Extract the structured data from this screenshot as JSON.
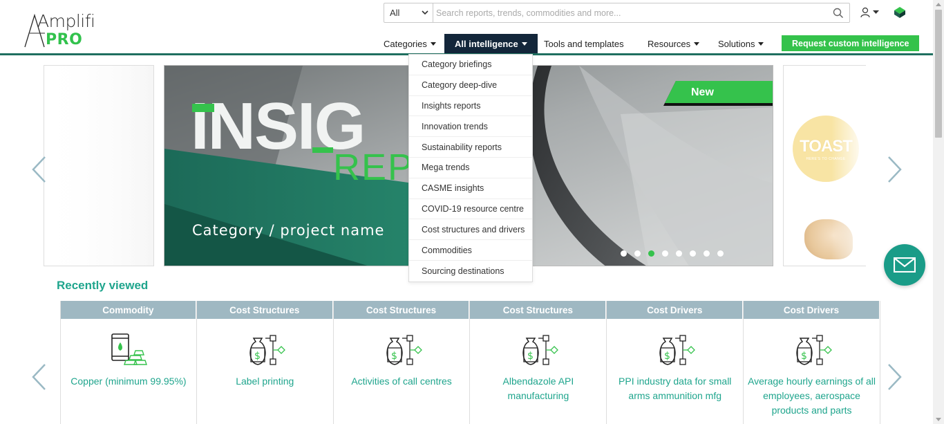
{
  "brand": {
    "logo_top": "Amplifi",
    "logo_bottom": "PRO"
  },
  "search": {
    "scope": "All",
    "placeholder": "Search reports, trends, commodities and more...",
    "value": ""
  },
  "nav": {
    "categories": "Categories",
    "all_intelligence": "All intelligence",
    "tools": "Tools and templates",
    "resources": "Resources",
    "solutions": "Solutions",
    "request": "Request custom intelligence"
  },
  "dropdown": {
    "items": [
      "Category briefings",
      "Category deep-dive",
      "Insights reports",
      "Innovation trends",
      "Sustainability reports",
      "Mega trends",
      "CASME insights",
      "COVID-19 resource centre",
      "Cost structures and drivers",
      "Commodities",
      "Sourcing destinations"
    ]
  },
  "slide": {
    "hero_word": "INSIG",
    "hero_sub": "REP",
    "title": "Category / project name",
    "badge": "New",
    "dot_count": 8,
    "active_dot": 3
  },
  "side_slide": {
    "brand_word": "TOAST",
    "tagline": "HERE'S TO CHANGE"
  },
  "recent": {
    "title": "Recently viewed",
    "cards": [
      {
        "type": "Commodity",
        "name": "Copper (minimum 99.95%)",
        "icon": "commodity-barrel-icon"
      },
      {
        "type": "Cost Structures",
        "name": "Label printing",
        "icon": "money-bag-flow-icon"
      },
      {
        "type": "Cost Structures",
        "name": "Activities of call centres",
        "icon": "money-bag-flow-icon"
      },
      {
        "type": "Cost Structures",
        "name": "Albendazole API manufacturing",
        "icon": "money-bag-flow-icon"
      },
      {
        "type": "Cost Drivers",
        "name": "PPI industry data for small arms ammunition mfg",
        "icon": "money-bag-flow-icon"
      },
      {
        "type": "Cost Drivers",
        "name": "Average hourly earnings of all employees, aerospace products and parts",
        "icon": "money-bag-flow-icon"
      }
    ]
  },
  "colors": {
    "accent_green": "#34c24b",
    "teal": "#1fa58d",
    "navy": "#13263a",
    "card_header": "#9fb8c2"
  }
}
